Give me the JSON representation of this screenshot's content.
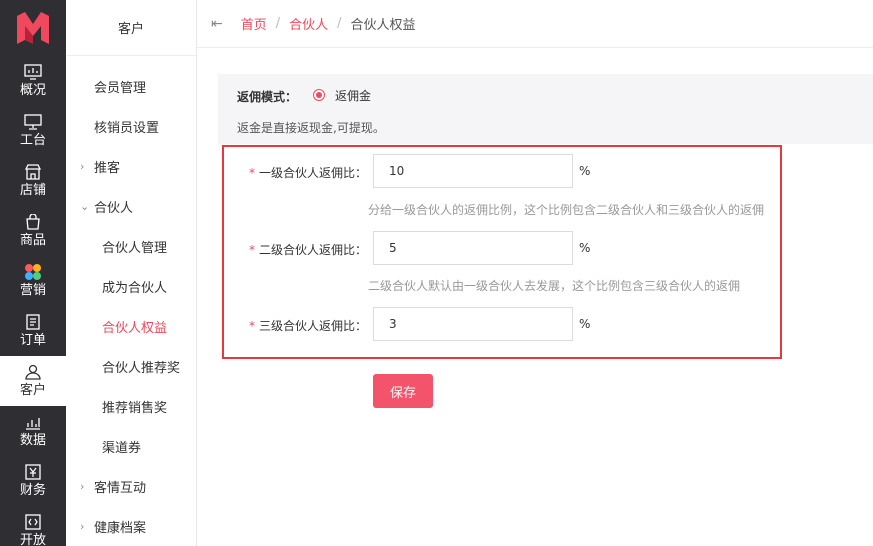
{
  "rail": {
    "items": [
      {
        "label": "概况",
        "icon": "monitor-chart-icon"
      },
      {
        "label": "工台",
        "icon": "desktop-icon"
      },
      {
        "label": "店铺",
        "icon": "store-icon"
      },
      {
        "label": "商品",
        "icon": "bag-icon"
      },
      {
        "label": "营销",
        "icon": "marketing-color-icon"
      },
      {
        "label": "订单",
        "icon": "order-icon"
      },
      {
        "label": "客户",
        "icon": "user-icon"
      },
      {
        "label": "数据",
        "icon": "data-chart-icon"
      },
      {
        "label": "财务",
        "icon": "finance-icon"
      },
      {
        "label": "开放",
        "icon": "code-icon"
      }
    ]
  },
  "sidebar": {
    "title": "客户",
    "items": [
      {
        "label": "会员管理"
      },
      {
        "label": "核销员设置"
      },
      {
        "label": "推客",
        "arrow": "›"
      },
      {
        "label": "合伙人",
        "arrow": "⌄"
      },
      {
        "label": "合伙人管理"
      },
      {
        "label": "成为合伙人"
      },
      {
        "label": "合伙人权益"
      },
      {
        "label": "合伙人推荐奖"
      },
      {
        "label": "推荐销售奖"
      },
      {
        "label": "渠道券"
      },
      {
        "label": "客情互动",
        "arrow": "›"
      },
      {
        "label": "健康档案",
        "arrow": "›"
      }
    ]
  },
  "breadcrumb": {
    "back_icon": "⇤",
    "home": "首页",
    "parent": "合伙人",
    "current": "合伙人权益",
    "separator": "/"
  },
  "mode": {
    "label": "返佣模式：",
    "option": "返佣金",
    "description": "返金是直接返现金,可提现。"
  },
  "form": {
    "required_mark": "*",
    "unit": "%",
    "level1": {
      "label": "一级合伙人返佣比：",
      "value": "10",
      "hint": "分给一级合伙人的返佣比例，这个比例包含二级合伙人和三级合伙人的返佣"
    },
    "level2": {
      "label": "二级合伙人返佣比：",
      "value": "5",
      "hint": "二级合伙人默认由一级合伙人去发展，这个比例包含三级合伙人的返佣"
    },
    "level3": {
      "label": "三级合伙人返佣比：",
      "value": "3"
    },
    "save_label": "保存"
  },
  "colors": {
    "accent": "#f0485e",
    "rail_bg": "#2f2f33",
    "highlight_frame": "#e8383d"
  }
}
